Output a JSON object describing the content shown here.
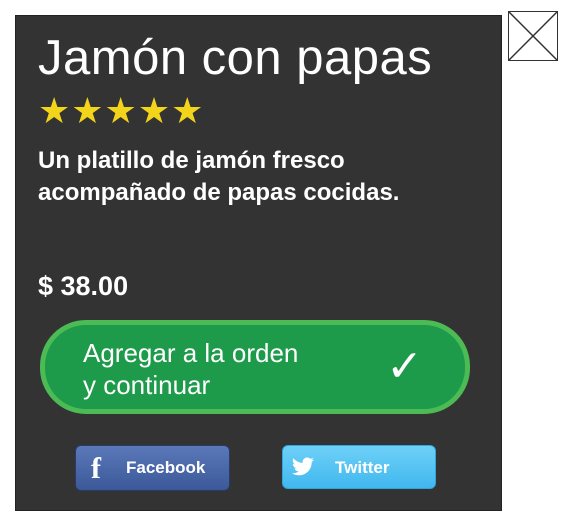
{
  "product": {
    "title": "Jamón con papas",
    "rating_stars": "★★★★★",
    "rating": 5,
    "description": "Un platillo de jamón fresco acompañado de papas cocidas.",
    "price": "$ 38.00"
  },
  "actions": {
    "add_label_line1": "Agregar a la orden",
    "add_label_line2": "y continuar",
    "check_icon": "check-icon"
  },
  "social": {
    "facebook_label": "Facebook",
    "twitter_label": "Twitter"
  },
  "colors": {
    "panel": "#333333",
    "stars": "#f2d51a",
    "add_button": "#1d9a4a",
    "add_button_border": "#4cbb55",
    "facebook": "#3b5998",
    "twitter": "#41b8ee"
  },
  "icons": [
    "star-icon",
    "check-icon",
    "facebook-icon",
    "twitter-icon",
    "close-icon"
  ]
}
